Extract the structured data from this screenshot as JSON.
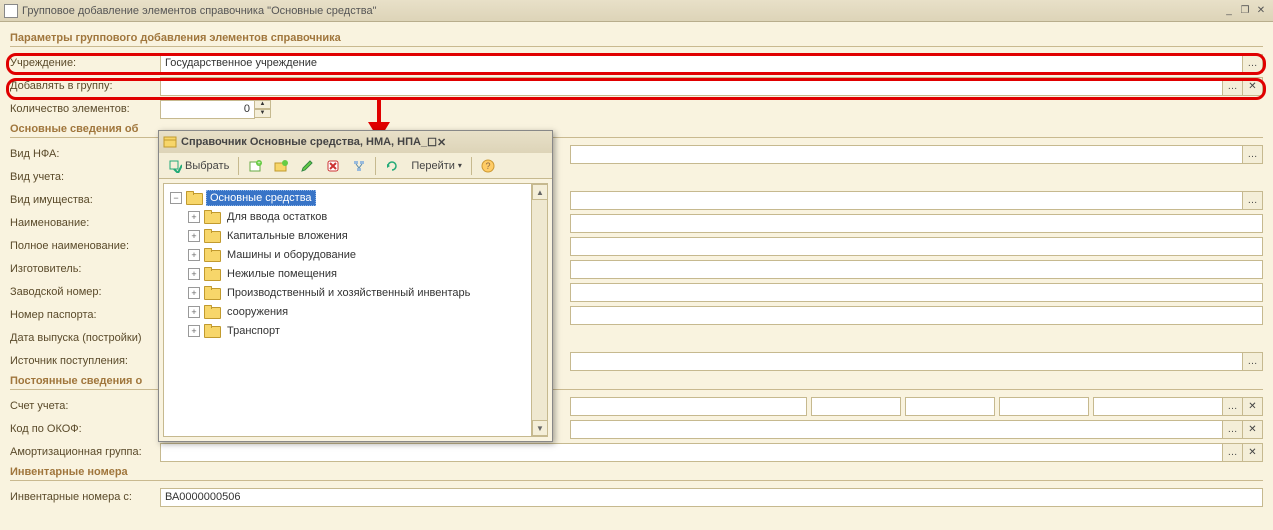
{
  "window": {
    "title": "Групповое добавление элементов справочника \"Основные средства\""
  },
  "section_params_title": "Параметры группового добавления элементов справочника",
  "labels": {
    "org": "Учреждение:",
    "group": "Добавлять в группу:",
    "count": "Количество элементов:",
    "section_main": "Основные сведения об",
    "type_nfa": "Вид НФА:",
    "type_accounting": "Вид учета:",
    "type_property": "Вид имущества:",
    "name": "Наименование:",
    "full_name": "Полное наименование:",
    "manufacturer": "Изготовитель:",
    "factory_num": "Заводской номер:",
    "passport_num": "Номер паспорта:",
    "date_build": "Дата выпуска (постройки)",
    "source": "Источник поступления:",
    "section_const": "Постоянные сведения о",
    "account": "Счет учета:",
    "okof": "Код по ОКОФ:",
    "amort_group": "Амортизационная группа:",
    "section_inv": "Инвентарные номера",
    "inv_from": "Инвентарные номера с:"
  },
  "values": {
    "org": "Государственное учреждение",
    "group": "",
    "count": "0",
    "inv_from": "ВА0000000506"
  },
  "dialog": {
    "title": "Справочник Основные средства, НМА, НПА",
    "toolbar": {
      "select": "Выбрать",
      "goto": "Перейти"
    },
    "tree": {
      "root": "Основные средства",
      "children": [
        "Для ввода остатков",
        "Капитальные вложения",
        "Машины и оборудование",
        "Нежилые помещения",
        "Производственный и хозяйственный инвентарь",
        "сооружения",
        "Транспорт"
      ]
    }
  }
}
